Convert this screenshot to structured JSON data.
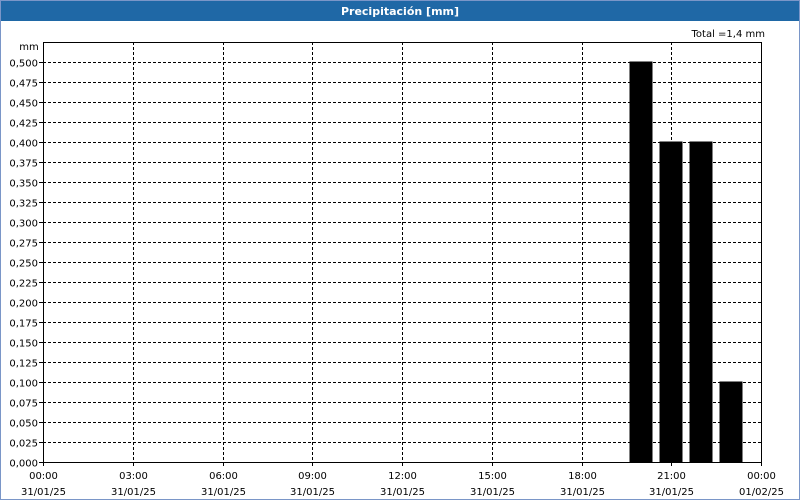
{
  "window": {
    "title": "Precipitación [mm]"
  },
  "chart_data": {
    "type": "bar",
    "title": "Precipitación [mm]",
    "ylabel": "mm",
    "total_label": "Total =1,4 mm",
    "ylim": [
      0,
      0.5
    ],
    "y_ticks": [
      "0,000",
      "0,025",
      "0,050",
      "0,075",
      "0,100",
      "0,125",
      "0,150",
      "0,175",
      "0,200",
      "0,225",
      "0,250",
      "0,275",
      "0,300",
      "0,325",
      "0,350",
      "0,375",
      "0,400",
      "0,425",
      "0,450",
      "0,475",
      "0,500"
    ],
    "x_ticks": [
      {
        "time": "00:00",
        "date": "31/01/25"
      },
      {
        "time": "03:00",
        "date": "31/01/25"
      },
      {
        "time": "06:00",
        "date": "31/01/25"
      },
      {
        "time": "09:00",
        "date": "31/01/25"
      },
      {
        "time": "12:00",
        "date": "31/01/25"
      },
      {
        "time": "15:00",
        "date": "31/01/25"
      },
      {
        "time": "18:00",
        "date": "31/01/25"
      },
      {
        "time": "21:00",
        "date": "31/01/25"
      },
      {
        "time": "00:00",
        "date": "01/02/25"
      }
    ],
    "x_range_hours": [
      0,
      24
    ],
    "bars": [
      {
        "time": "20:00",
        "hours": 20,
        "value": 0.5
      },
      {
        "time": "21:00",
        "hours": 21,
        "value": 0.4
      },
      {
        "time": "22:00",
        "hours": 22,
        "value": 0.4
      },
      {
        "time": "23:00",
        "hours": 23,
        "value": 0.1
      }
    ],
    "bar_color": "#000000",
    "grid": true
  }
}
